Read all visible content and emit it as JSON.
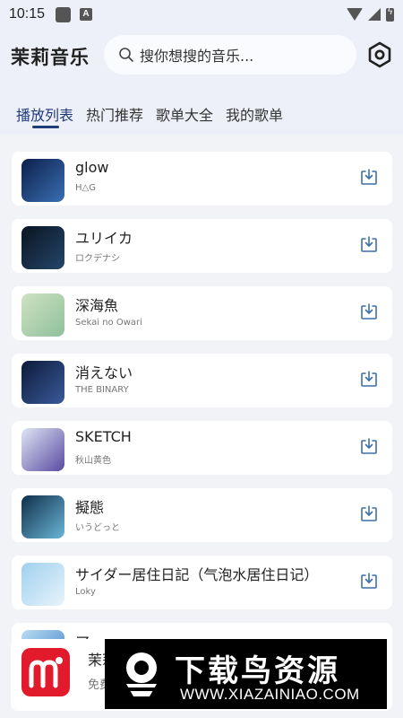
{
  "status_bar": {
    "time": "10:15"
  },
  "app": {
    "title": "茉莉音乐"
  },
  "search": {
    "placeholder": "搜你想搜的音乐..."
  },
  "tabs": [
    {
      "label": "播放列表",
      "active": true
    },
    {
      "label": "热门推荐",
      "active": false
    },
    {
      "label": "歌单大全",
      "active": false
    },
    {
      "label": "我的歌单",
      "active": false
    }
  ],
  "songs": [
    {
      "title": "glow",
      "artist": "H△G",
      "cover_colors": [
        "#0b1f4a",
        "#3a6fb3"
      ]
    },
    {
      "title": "ユリイカ",
      "artist": "ロクデナシ",
      "cover_colors": [
        "#0a1420",
        "#24466a"
      ]
    },
    {
      "title": "深海魚",
      "artist": "Sekai no Owari",
      "cover_colors": [
        "#cfe3c2",
        "#8fbf9a"
      ]
    },
    {
      "title": "消えない",
      "artist": "THE BINARY",
      "cover_colors": [
        "#0c1a3a",
        "#3b5a9a"
      ]
    },
    {
      "title": "SKETCH",
      "artist": "秋山黄色",
      "cover_colors": [
        "#dfe6f5",
        "#5a4aa0"
      ]
    },
    {
      "title": "擬態",
      "artist": "いうどっと",
      "cover_colors": [
        "#0f2f4a",
        "#6ab6d6"
      ]
    },
    {
      "title": "サイダー居住日記（气泡水居住日记）",
      "artist": "Loky",
      "cover_colors": [
        "#9fd0ee",
        "#e8f3fb"
      ]
    },
    {
      "title": "ア",
      "artist": "",
      "cover_colors": [
        "#b9dcf4",
        "#3a7fc2"
      ]
    }
  ],
  "player": {
    "title": "茉莉",
    "subtitle": "免费"
  },
  "watermark": {
    "title": "下载鸟资源",
    "url": "WWW.XIAZAINIAO.COM"
  },
  "colors": {
    "accent": "#1f3a7a",
    "background": "#f2f3f7",
    "header_bg": "#eef0f9",
    "download_icon": "#3d6fa8",
    "logo_red": "#e11b2c"
  }
}
